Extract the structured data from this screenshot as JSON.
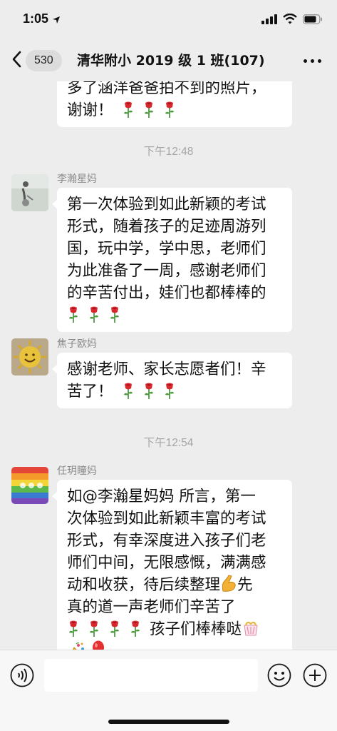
{
  "status_bar": {
    "time": "1:05"
  },
  "nav": {
    "unread_count": "530",
    "title": "清华附小 2019 级 1 班(107)"
  },
  "messages": [
    {
      "lines": [
        "多了涵洋爸爸拍不到的照片，",
        "谢谢！"
      ]
    },
    {
      "timestamp": "下午12:48"
    },
    {
      "sender": "李瀚星妈",
      "lines": [
        "第一次体验到如此新颖的考试",
        "形式，随着孩子的足迹周游列",
        "国，玩中学，学中思，老师们",
        "为此准备了一周，感谢老师们",
        "的辛苦付出，娃们也都棒棒的"
      ]
    },
    {
      "sender": "焦子欧妈",
      "lines": [
        "感谢老师、家长志愿者们！辛",
        "苦了！"
      ]
    },
    {
      "timestamp": "下午12:54"
    },
    {
      "sender": "任玥瞳妈",
      "lines": [
        "如@李瀚星妈妈 所言，第一",
        "次体验到如此新颖丰富的考试",
        "形式，有幸深度进入孩子们老",
        "师们中间，无限感慨，满满感",
        "动和收获，待后续整理",
        "先真的道一声老师们辛苦了",
        "孩子们棒棒哒"
      ]
    }
  ],
  "icons": [
    "back-icon",
    "more-icon",
    "rose-emoji",
    "muscle-emoji",
    "party-popper-emoji",
    "balloon-emoji",
    "gift-emoji",
    "voice-icon",
    "emoji-icon",
    "plus-icon"
  ]
}
